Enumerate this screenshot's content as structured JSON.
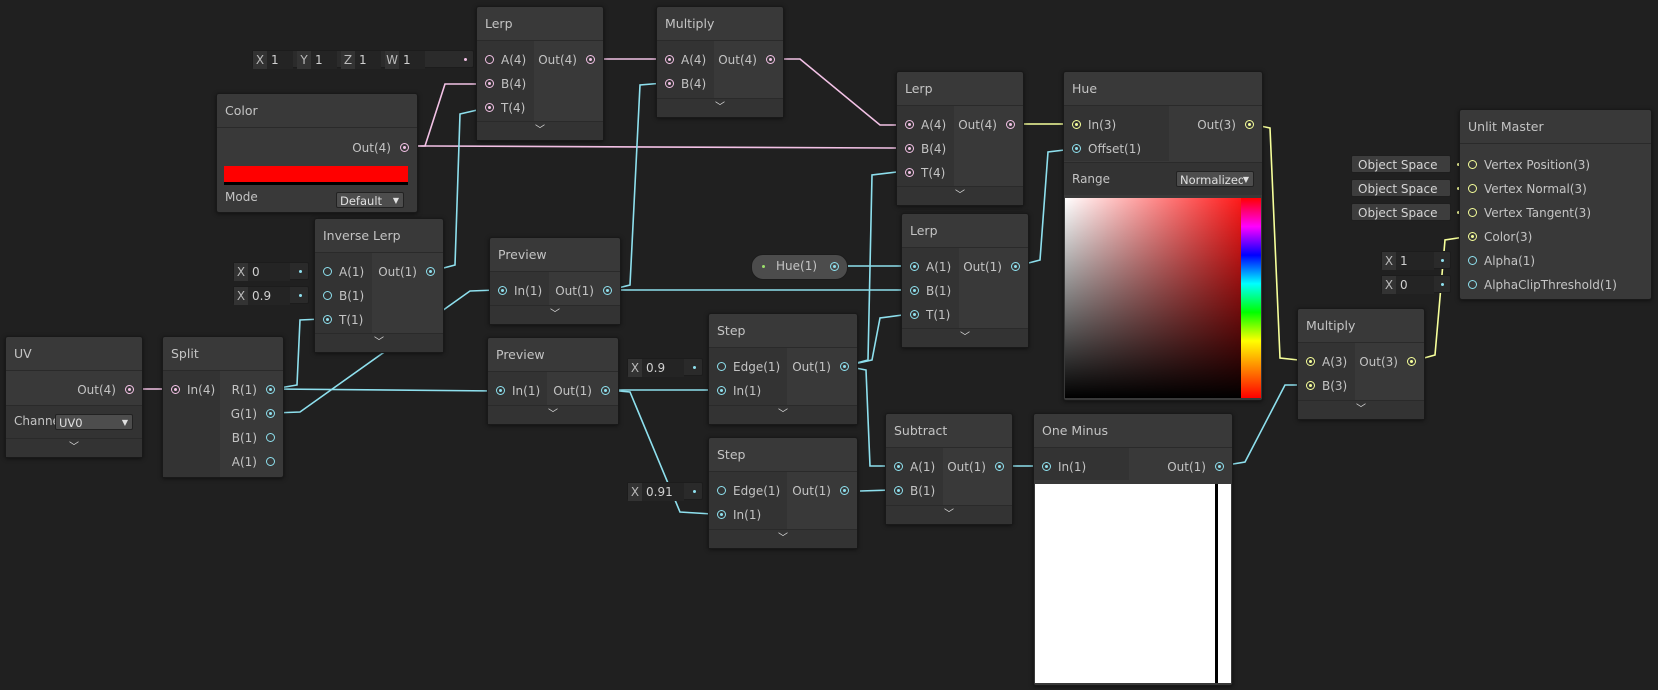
{
  "colors": {
    "vector4": "#f3c2e6",
    "vector1": "#8ee0ee",
    "vector3": "#f6ff9a",
    "canvas": "#202020",
    "node": "#393939",
    "color_swatch": "#ff0000"
  },
  "icons": {
    "collapse": "chevron-down-icon"
  },
  "nodes": {
    "uv": {
      "title": "UV",
      "out": "Out(4)",
      "channel_label": "Channel",
      "channel_value": "UV0"
    },
    "split": {
      "title": "Split",
      "in": "In(4)",
      "r": "R(1)",
      "g": "G(1)",
      "b": "B(1)",
      "a": "A(1)"
    },
    "color": {
      "title": "Color",
      "out": "Out(4)",
      "mode_label": "Mode",
      "mode_value": "Default"
    },
    "lerp1": {
      "title": "Lerp",
      "a": "A(4)",
      "b": "B(4)",
      "t": "T(4)",
      "out": "Out(4)",
      "a_x_label": "X",
      "a_x": "1",
      "a_y_label": "Y",
      "a_y": "1",
      "a_z_label": "Z",
      "a_z": "1",
      "a_w_label": "W",
      "a_w": "1"
    },
    "multiply1": {
      "title": "Multiply",
      "a": "A(4)",
      "b": "B(4)",
      "out": "Out(4)"
    },
    "inverse_lerp": {
      "title": "Inverse Lerp",
      "a": "A(1)",
      "b": "B(1)",
      "t": "T(1)",
      "out": "Out(1)",
      "a_label": "X",
      "a_value": "0",
      "b_label": "X",
      "b_value": "0.9"
    },
    "preview1": {
      "title": "Preview",
      "in": "In(1)",
      "out": "Out(1)"
    },
    "preview2": {
      "title": "Preview",
      "in": "In(1)",
      "out": "Out(1)"
    },
    "step1": {
      "title": "Step",
      "edge": "Edge(1)",
      "in": "In(1)",
      "out": "Out(1)",
      "edge_label": "X",
      "edge_value": "0.9"
    },
    "step2": {
      "title": "Step",
      "edge": "Edge(1)",
      "in": "In(1)",
      "out": "Out(1)",
      "edge_label": "X",
      "edge_value": "0.91"
    },
    "hue_prop": {
      "label": "Hue(1)"
    },
    "lerp2": {
      "title": "Lerp",
      "a": "A(4)",
      "b": "B(4)",
      "t": "T(4)",
      "out": "Out(4)"
    },
    "lerp3": {
      "title": "Lerp",
      "a": "A(1)",
      "b": "B(1)",
      "t": "T(1)",
      "out": "Out(1)"
    },
    "subtract": {
      "title": "Subtract",
      "a": "A(1)",
      "b": "B(1)",
      "out": "Out(1)"
    },
    "hue": {
      "title": "Hue",
      "in": "In(3)",
      "offset": "Offset(1)",
      "out": "Out(3)",
      "range_label": "Range",
      "range_value": "Normalized"
    },
    "one_minus": {
      "title": "One Minus",
      "in": "In(1)",
      "out": "Out(1)"
    },
    "multiply2": {
      "title": "Multiply",
      "a": "A(3)",
      "b": "B(3)",
      "out": "Out(3)"
    },
    "master": {
      "title": "Unlit Master",
      "vpos": "Vertex Position(3)",
      "vnorm": "Vertex Normal(3)",
      "vtan": "Vertex Tangent(3)",
      "color": "Color(3)",
      "alpha": "Alpha(1)",
      "clip": "AlphaClipThreshold(1)",
      "space1": "Object Space",
      "space2": "Object Space",
      "space3": "Object Space",
      "alpha_label": "X",
      "alpha_value": "1",
      "clip_label": "X",
      "clip_value": "0"
    }
  }
}
